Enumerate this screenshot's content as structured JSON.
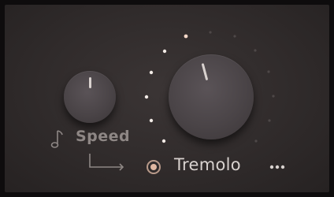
{
  "speed": {
    "label": "Speed",
    "knob_name": "speed-knob"
  },
  "tremolo": {
    "label": "Tremolo",
    "enabled": true,
    "more_label": "•••"
  },
  "icons": {
    "note": "music-note-icon",
    "sync": "sync-arrow-icon",
    "radio": "radio-button-icon",
    "more": "more-options-icon"
  },
  "colors": {
    "background": "#302b2b",
    "knob": "#4a4447",
    "indicator": "#d9d2cf",
    "label_muted": "#8e8785",
    "label_bright": "#d8d2cf",
    "accent": "#e0b8a2",
    "dot_bright": "#f2ebe6",
    "dot_dim": "#4e4848"
  },
  "tremolo_level": {
    "active_dots": 6,
    "total_dots": 14
  }
}
